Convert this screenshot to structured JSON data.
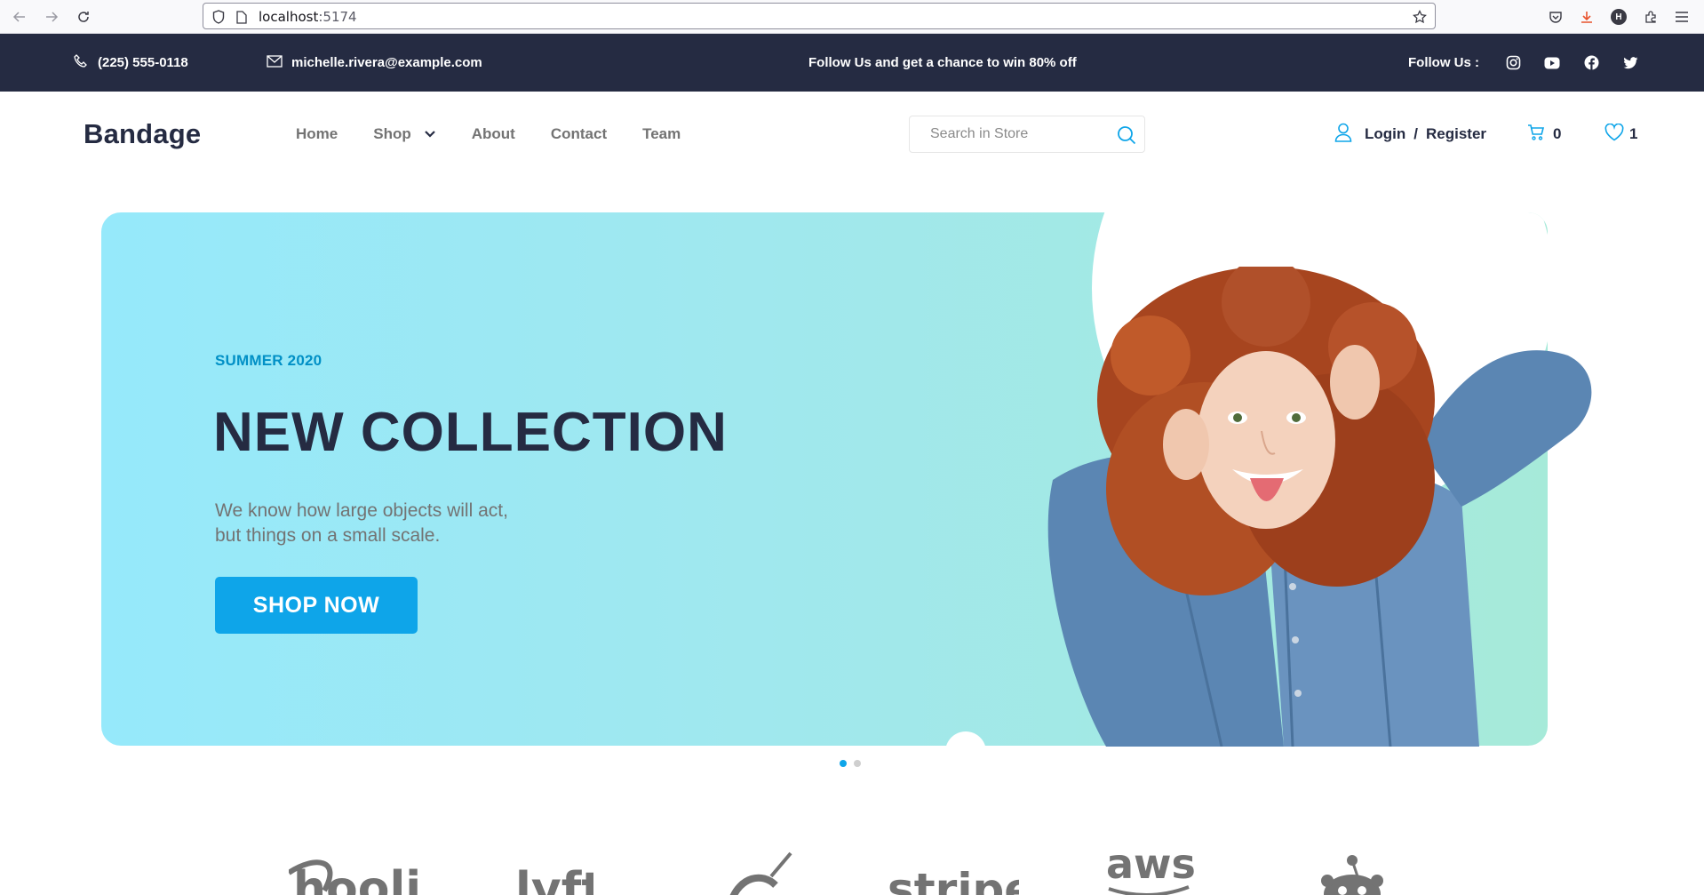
{
  "browser": {
    "url_host": "localhost",
    "url_port": ":5174"
  },
  "topbar": {
    "phone": "(225) 555-0118",
    "email": "michelle.rivera@example.com",
    "promo": "Follow Us  and get a chance to win 80% off",
    "follow_label": "Follow Us  :",
    "social": [
      "instagram-icon",
      "youtube-icon",
      "facebook-icon",
      "twitter-icon"
    ]
  },
  "header": {
    "brand": "Bandage",
    "menu": {
      "home": "Home",
      "shop": "Shop",
      "about": "About",
      "contact": "Contact",
      "team": "Team"
    },
    "search_placeholder": "Search in Store",
    "login": "Login",
    "separator": "/",
    "register": "Register",
    "cart_count": "0",
    "wishlist_count": "1"
  },
  "hero": {
    "eyebrow": "SUMMER 2020",
    "title": "NEW COLLECTION",
    "desc_line1": "We know how large objects will act,",
    "desc_line2": "but things on a small scale.",
    "cta": "SHOP NOW",
    "slides": 2,
    "active_slide": 1
  },
  "brands": [
    "hooli",
    "lyft",
    "pied-piper",
    "stripe",
    "aws",
    "reddit"
  ],
  "colors": {
    "dark": "#252B42",
    "accent": "#0EA5E9",
    "muted": "#737373",
    "hero_start": "#96E9FB",
    "hero_end": "#A6EAD9"
  }
}
